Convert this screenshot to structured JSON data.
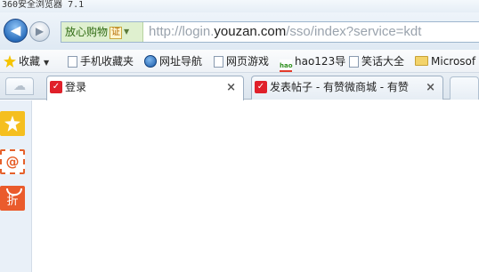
{
  "window": {
    "title": "360安全浏览器 7.1"
  },
  "nav": {
    "back_glyph": "◀",
    "forward_glyph": "▶",
    "safe_badge": "放心购物",
    "cert_badge": "证",
    "url_prefix": "http://login.",
    "url_domain": "youzan.com",
    "url_suffix": "/sso/index?service=kdt"
  },
  "favorites": {
    "bookmarks_label": "收藏",
    "items": [
      {
        "label": "手机收藏夹",
        "icon": "document-icon"
      },
      {
        "label": "网址导航",
        "icon": "globe-icon"
      },
      {
        "label": "网页游戏",
        "icon": "document-icon"
      },
      {
        "label": "hao123导",
        "icon": "hao123-icon"
      },
      {
        "label": "笑话大全",
        "icon": "document-icon"
      },
      {
        "label": "Microsof",
        "icon": "folder-icon"
      }
    ]
  },
  "tabs": [
    {
      "label": "登录",
      "active": true
    },
    {
      "label": "发表帖子 - 有赞微商城 - 有赞",
      "active": false
    }
  ],
  "sidebar": {
    "mail_glyph": "@",
    "discount_glyph": "折"
  },
  "colors": {
    "brand_red": "#e0202a",
    "sidebar_bg": "#e9f0f8",
    "safe_green": "#2e6a12"
  }
}
